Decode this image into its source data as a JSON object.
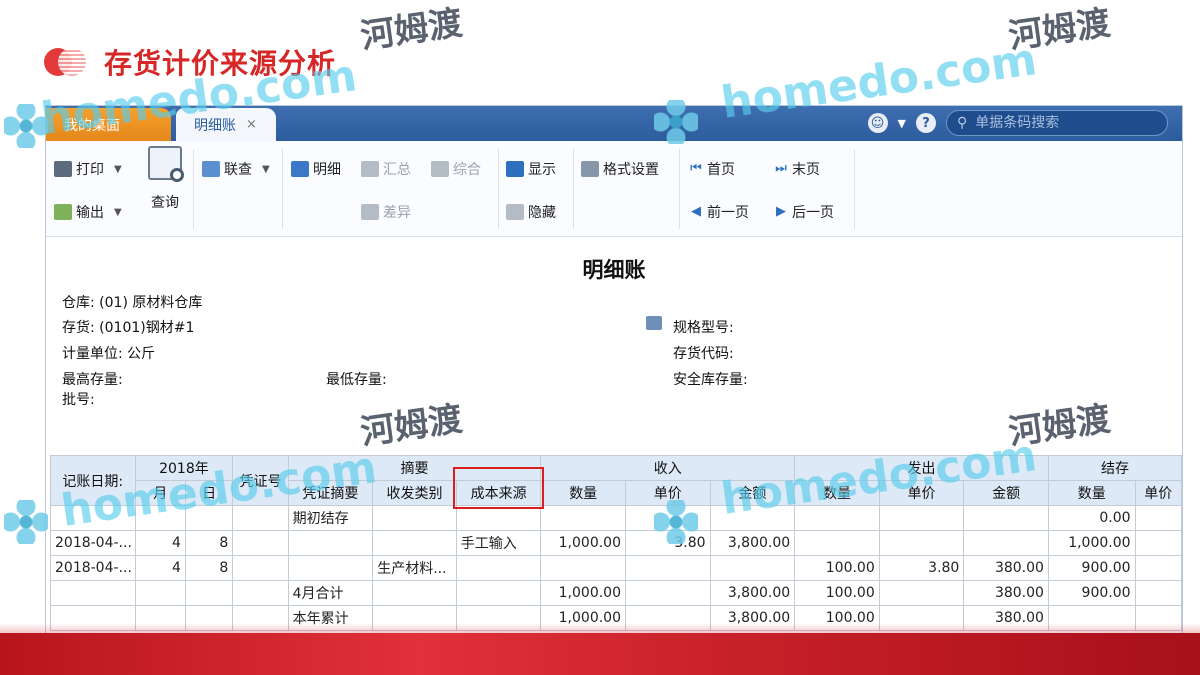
{
  "slide": {
    "title": "存货计价来源分析"
  },
  "watermark": {
    "brand": "homedo.com",
    "cn": "河姆渡"
  },
  "app": {
    "tabs": [
      {
        "label": "我的桌面"
      },
      {
        "label": "明细账"
      }
    ],
    "tab_close": "×",
    "search_placeholder": "单据条码搜索"
  },
  "toolbar": {
    "print": "打印",
    "export": "输出",
    "query": "查询",
    "link_query": "联查",
    "detail": "明细",
    "summary": "汇总",
    "composite": "综合",
    "difference": "差异",
    "show": "显示",
    "hide": "隐藏",
    "format": "格式设置",
    "first_page": "首页",
    "last_page": "末页",
    "prev_page": "前一页",
    "next_page": "后一页"
  },
  "report": {
    "title": "明细账",
    "warehouse": "仓库: (01) 原材料仓库",
    "inventory": "存货: (0101)钢材#1",
    "unit": "计量单位: 公斤",
    "max_stock": "最高存量:",
    "min_stock": "最低存量:",
    "batch": "批号:",
    "spec": "规格型号:",
    "inventory_code": "存货代码:",
    "safety_stock": "安全库存量:"
  },
  "table": {
    "headers": {
      "post_date": "记账日期:",
      "year": "2018年",
      "month": "月",
      "day": "日",
      "voucher_no": "凭证号",
      "summary": "摘要",
      "voucher_summary": "凭证摘要",
      "io_category": "收发类别",
      "cost_source": "成本来源",
      "income": "收入",
      "outgo": "发出",
      "balance": "结存",
      "qty": "数量",
      "price": "单价",
      "amount": "金额"
    },
    "rows": [
      {
        "date": "",
        "month": "",
        "day": "",
        "voucher": "",
        "summary": "期初结存",
        "category": "",
        "source": "",
        "in_qty": "",
        "in_price": "",
        "in_amt": "",
        "out_qty": "",
        "out_price": "",
        "out_amt": "",
        "bal_qty": "0.00",
        "bal_price": ""
      },
      {
        "date": "2018-04-...",
        "month": "4",
        "day": "8",
        "voucher": "",
        "summary": "",
        "category": "",
        "source": "手工输入",
        "in_qty": "1,000.00",
        "in_price": "3.80",
        "in_amt": "3,800.00",
        "out_qty": "",
        "out_price": "",
        "out_amt": "",
        "bal_qty": "1,000.00",
        "bal_price": ""
      },
      {
        "date": "2018-04-...",
        "month": "4",
        "day": "8",
        "voucher": "",
        "summary": "",
        "category": "生产材料...",
        "source": "",
        "in_qty": "",
        "in_price": "",
        "in_amt": "",
        "out_qty": "100.00",
        "out_price": "3.80",
        "out_amt": "380.00",
        "bal_qty": "900.00",
        "bal_price": ""
      },
      {
        "date": "",
        "month": "",
        "day": "",
        "voucher": "",
        "summary": "4月合计",
        "category": "",
        "source": "",
        "in_qty": "1,000.00",
        "in_price": "",
        "in_amt": "3,800.00",
        "out_qty": "100.00",
        "out_price": "",
        "out_amt": "380.00",
        "bal_qty": "900.00",
        "bal_price": ""
      },
      {
        "date": "",
        "month": "",
        "day": "",
        "voucher": "",
        "summary": "本年累计",
        "category": "",
        "source": "",
        "in_qty": "1,000.00",
        "in_price": "",
        "in_amt": "3,800.00",
        "out_qty": "100.00",
        "out_price": "",
        "out_amt": "380.00",
        "bal_qty": "",
        "bal_price": ""
      }
    ]
  },
  "colors": {
    "title_red": "#d62626",
    "tab_bar_blue": "#2c5b9e",
    "tab_home_orange": "#f4a12f",
    "highlight_red": "#d81e1e",
    "header_bg": "#dde9f6"
  }
}
